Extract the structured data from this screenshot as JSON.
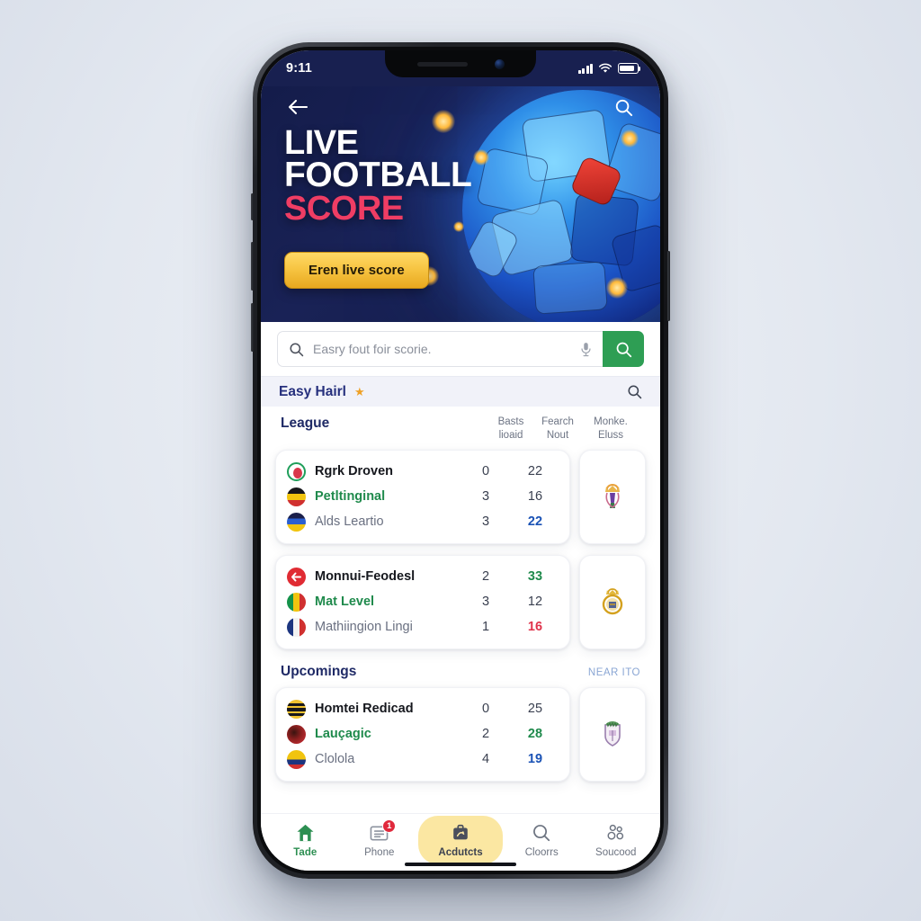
{
  "status_bar": {
    "time": "9:11",
    "signal_icon": "cellular-bars-icon",
    "wifi_icon": "wifi-icon",
    "battery_icon": "battery-icon"
  },
  "hero": {
    "back_icon": "back-arrow-icon",
    "search_icon": "search-icon",
    "line1": "LIVE",
    "line2": "FOOTBALL",
    "line3": "SCORE",
    "cta_label": "Eren live score",
    "bg_color": "#182050",
    "accent_red": "#ef3d64",
    "cta_gold": "#f7c543",
    "ball_icon": "soccer-ball-graphic"
  },
  "search": {
    "placeholder": "Easry fout foir scorie.",
    "value": "",
    "left_icon": "search-icon",
    "mic_icon": "microphone-icon",
    "submit_icon": "search-icon",
    "submit_color": "#2e9e54"
  },
  "strip": {
    "title": "Easy Hairl",
    "star_icon": "star-icon",
    "search_icon": "search-icon"
  },
  "columns": {
    "league": "League",
    "col1_line1": "Basts",
    "col1_line2": "lioaid",
    "col2_line1": "Fearch",
    "col2_line2": "Nout",
    "col3_line1": "Monke.",
    "col3_line2": "Eluss"
  },
  "cards": [
    {
      "crest": "crest-blue-lion",
      "teams": [
        {
          "name": "Rgrk Droven",
          "flag": "flag-green-ring",
          "score_a": "0",
          "score_b": "22",
          "name_style": "bold",
          "score_style": "dark"
        },
        {
          "name": "Petltinginal",
          "flag": "flag-germany",
          "score_a": "3",
          "score_b": "16",
          "name_style": "green",
          "score_style": "dark"
        },
        {
          "name": "Alds Leartio",
          "flag": "flag-blue-yellow",
          "score_a": "3",
          "score_b": "22",
          "name_style": "gray",
          "score_style": "blue"
        }
      ]
    },
    {
      "crest": "crest-gold-madrid",
      "teams": [
        {
          "name": "Monnui-Feodesl",
          "flag": "flag-red-arrow",
          "score_a": "2",
          "score_b": "33",
          "name_style": "bold",
          "score_style": "green"
        },
        {
          "name": "Mat Level",
          "flag": "flag-mali",
          "score_a": "3",
          "score_b": "12",
          "name_style": "green",
          "score_style": "dark"
        },
        {
          "name": "Mathiingion Lingi",
          "flag": "flag-france",
          "score_a": "1",
          "score_b": "16",
          "name_style": "gray",
          "score_style": "red"
        }
      ]
    }
  ],
  "upcoming": {
    "title": "Upcomings",
    "link": "NEAR ITO",
    "card": {
      "crest": "crest-saints",
      "teams": [
        {
          "name": "Homtei Redicad",
          "flag": "flag-yellow-black",
          "score_a": "0",
          "score_b": "25",
          "name_style": "bold",
          "score_style": "dark"
        },
        {
          "name": "Lauçagic",
          "flag": "flag-red-dark",
          "score_a": "2",
          "score_b": "28",
          "name_style": "green",
          "score_style": "green"
        },
        {
          "name": "Clolola",
          "flag": "flag-colombia",
          "score_a": "4",
          "score_b": "19",
          "name_style": "gray",
          "score_style": "blue"
        }
      ]
    }
  },
  "tabbar": [
    {
      "label": "Tade",
      "icon": "home-icon",
      "state": "active"
    },
    {
      "label": "Phone",
      "icon": "list-icon",
      "state": "normal",
      "badge": "1"
    },
    {
      "label": "Acdutcts",
      "icon": "briefcase-icon",
      "state": "pill"
    },
    {
      "label": "Cloorrs",
      "icon": "search-icon",
      "state": "normal"
    },
    {
      "label": "Soucood",
      "icon": "people-icon",
      "state": "normal"
    }
  ]
}
